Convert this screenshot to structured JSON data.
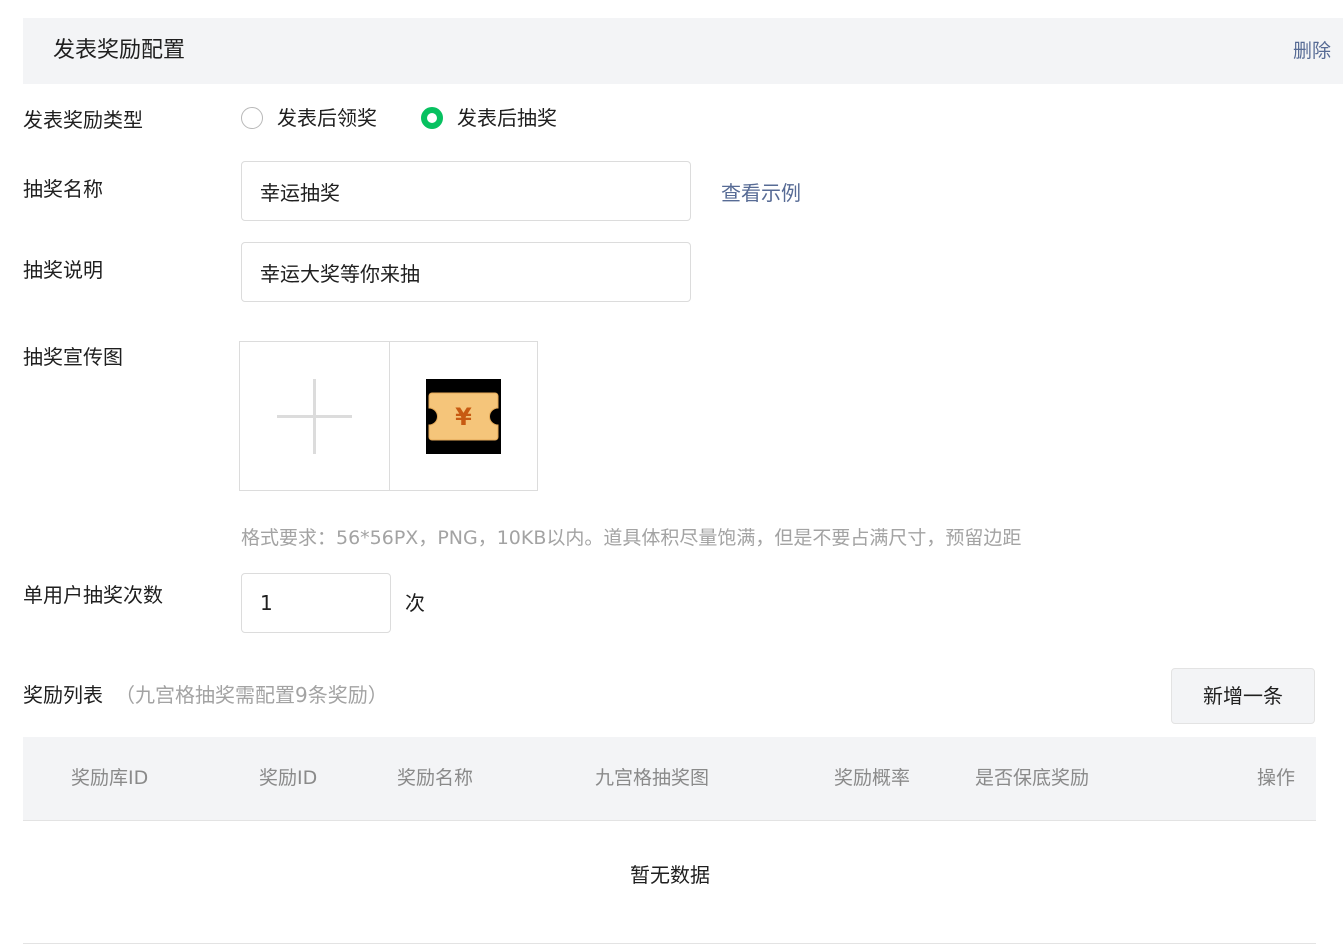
{
  "header": {
    "title": "发表奖励配置",
    "delete_label": "删除"
  },
  "form": {
    "reward_type": {
      "label": "发表奖励类型",
      "options": [
        {
          "label": "发表后领奖",
          "checked": false
        },
        {
          "label": "发表后抽奖",
          "checked": true
        }
      ]
    },
    "lottery_name": {
      "label": "抽奖名称",
      "value": "幸运抽奖",
      "example_link": "查看示例"
    },
    "lottery_desc": {
      "label": "抽奖说明",
      "value": "幸运大奖等你来抽"
    },
    "lottery_image": {
      "label": "抽奖宣传图",
      "hint": "格式要求：56*56PX，PNG，10KB以内。道具体积尽量饱满，但是不要占满尺寸，预留边距",
      "preview_icon": "yen-ticket-icon",
      "preview_symbol": "¥"
    },
    "draw_count": {
      "label": "单用户抽奖次数",
      "value": "1",
      "unit": "次"
    }
  },
  "reward_list": {
    "title": "奖励列表",
    "note": "（九宫格抽奖需配置9条奖励）",
    "add_button": "新增一条",
    "columns": [
      "奖励库ID",
      "奖励ID",
      "奖励名称",
      "九宫格抽奖图",
      "奖励概率",
      "是否保底奖励",
      "操作"
    ],
    "rows": [],
    "empty_text": "暂无数据"
  },
  "colors": {
    "accent_green": "#07c160",
    "link_blue": "#576b95",
    "header_bg": "#f3f4f6",
    "ticket_fill": "#f5c57a",
    "ticket_symbol": "#c75a12"
  }
}
